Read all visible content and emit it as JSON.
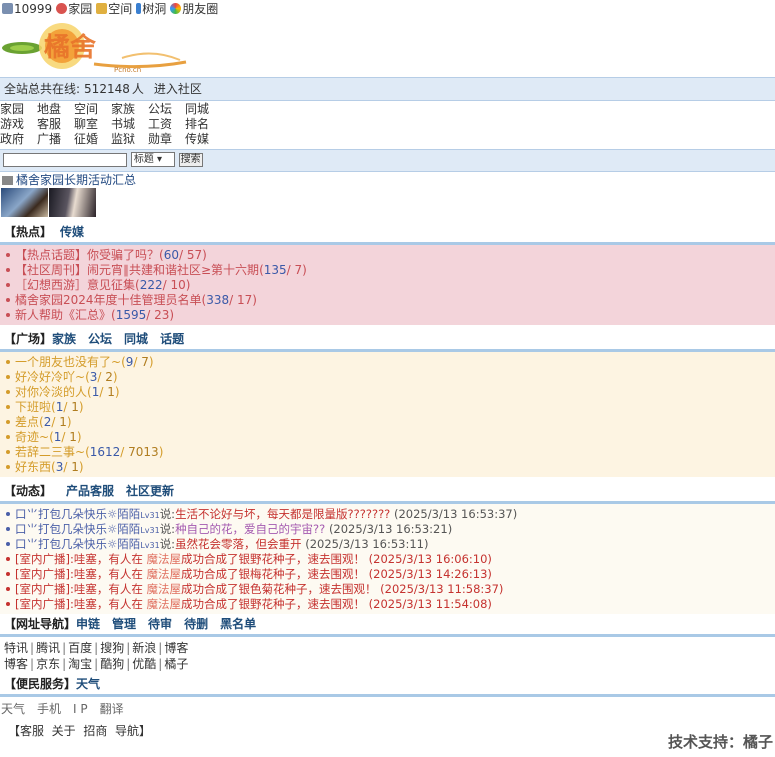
{
  "topbar": {
    "items": [
      {
        "label": "10999",
        "icon": "building-icon"
      },
      {
        "label": "家园",
        "icon": "home-icon"
      },
      {
        "label": "空间",
        "icon": "crown-icon"
      },
      {
        "label": "树洞",
        "icon": "feather-icon"
      },
      {
        "label": "朋友圈",
        "icon": "aperture-icon"
      }
    ]
  },
  "logo": {
    "sub": "Pcno.cn"
  },
  "online": {
    "prefix": "全站总共在线:",
    "count": "512148",
    "unit": "人",
    "enter": "进入社区"
  },
  "nav": {
    "rows": [
      [
        "家园",
        "地盘",
        "空间",
        "家族",
        "公坛",
        "同城"
      ],
      [
        "游戏",
        "客服",
        "聊室",
        "书城",
        "工资",
        "排名"
      ],
      [
        "政府",
        "广播",
        "征婚",
        "监狱",
        "勋章",
        "传媒"
      ]
    ]
  },
  "search": {
    "select": "标题",
    "button": "搜索"
  },
  "activity": {
    "label": "橘舍家园长期活动汇总"
  },
  "hot": {
    "tabs": [
      "【热点】",
      "传媒"
    ],
    "items": [
      {
        "text": "【热点话题】你受骗了吗？",
        "a": "60",
        "b": "57"
      },
      {
        "text": "【社区周刊】闹元宵∥共建和谐社区≥第十六期",
        "a": "135",
        "b": "7"
      },
      {
        "text": "［幻想西游］意见征集",
        "a": "222",
        "b": "10"
      },
      {
        "text": "橘舍家园2024年度十佳管理员名单",
        "a": "338",
        "b": "17"
      },
      {
        "text": "新人帮助《汇总》",
        "a": "1595",
        "b": "23"
      }
    ]
  },
  "plaza": {
    "tabs": [
      "【广场】",
      "家族",
      "公坛",
      "同城",
      "话题"
    ],
    "items": [
      {
        "text": "一个朋友也没有了~",
        "a": "9",
        "b": "7"
      },
      {
        "text": "好冷好冷吖~",
        "a": "3",
        "b": "2"
      },
      {
        "text": "对你冷淡的人",
        "a": "1",
        "b": "1"
      },
      {
        "text": "下班啦",
        "a": "1",
        "b": "1"
      },
      {
        "text": "差点",
        "a": "2",
        "b": "1"
      },
      {
        "text": "奇迹~",
        "a": "1",
        "b": "1"
      },
      {
        "text": "若辞二三事~",
        "a": "1612",
        "b": "7013"
      },
      {
        "text": "好东西",
        "a": "3",
        "b": "1"
      }
    ]
  },
  "dynamics": {
    "tabs": [
      "【动态】",
      "产品客服",
      "社区更新"
    ],
    "posts": [
      {
        "user": "口⺌打包几朵快乐☼陌陌",
        "lv": "Lv31",
        "said": "说:",
        "text": "生活不论好与坏，每天都是限量版???????",
        "time": "(2025/3/13 16:53:37)"
      },
      {
        "user": "口⺌打包几朵快乐☼陌陌",
        "lv": "Lv31",
        "said": "说:",
        "text": "种自己的花，爱自己的宇宙??",
        "time": "(2025/3/13 16:53:21)"
      },
      {
        "user": "口⺌打包几朵快乐☼陌陌",
        "lv": "Lv31",
        "said": "说:",
        "text": "虽然花会零落，但会重开",
        "time": "(2025/3/13 16:53:11)"
      }
    ],
    "broadcasts": [
      {
        "prefix": "[室内广播]:哇塞，有人在",
        "place": "魔法屋",
        "text": "成功合成了银野花种子，速去围观！",
        "time": "(2025/3/13 16:06:10)"
      },
      {
        "prefix": "[室内广播]:哇塞，有人在",
        "place": "魔法屋",
        "text": "成功合成了银梅花种子，速去围观！",
        "time": "(2025/3/13 14:26:13)"
      },
      {
        "prefix": "[室内广播]:哇塞，有人在",
        "place": "魔法屋",
        "text": "成功合成了银色菊花种子，速去围观！",
        "time": "(2025/3/13 11:58:37)"
      },
      {
        "prefix": "[室内广播]:哇塞，有人在",
        "place": "魔法屋",
        "text": "成功合成了银野花种子，速去围观！",
        "time": "(2025/3/13 11:54:08)"
      }
    ]
  },
  "urlnav": {
    "tabs": [
      "【网址导航】",
      "申链",
      "管理",
      "待审",
      "待删",
      "黑名单"
    ],
    "row1": [
      "特讯",
      "腾讯",
      "百度",
      "搜狗",
      "新浪",
      "博客"
    ],
    "row2": [
      "博客",
      "京东",
      "淘宝",
      "酷狗",
      "优酷",
      "橘子"
    ]
  },
  "service": {
    "tabs": [
      "【便民服务】",
      "天气"
    ],
    "links": [
      "天气",
      "手机",
      "I P",
      "翻译"
    ]
  },
  "footer": {
    "links": [
      "【客服",
      "关于",
      "招商",
      "导航】"
    ],
    "tech": "技术支持：橘子"
  },
  "colors": {
    "accent_blue": "#1f4d7a",
    "hot_red": "#c84e55",
    "plaza_gold": "#d49c2a",
    "divider": "#a9c9e6"
  }
}
